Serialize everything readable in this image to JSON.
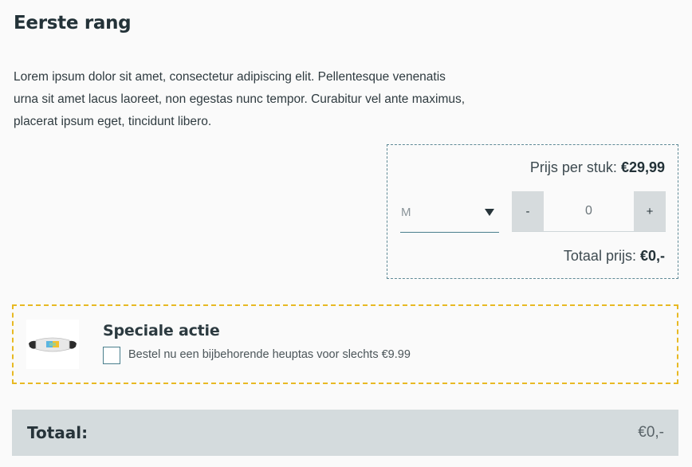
{
  "product": {
    "title": "Eerste rang",
    "description": "Lorem ipsum dolor sit amet, consectetur adipiscing elit. Pellentesque venenatis urna sit amet lacus laoreet, non egestas nunc tempor. Curabitur vel ante maximus, placerat ipsum eget, tincidunt libero."
  },
  "order": {
    "unit_price_label": "Prijs per stuk:",
    "unit_price_value": "€29,99",
    "size_selected": "M",
    "decrement_label": "-",
    "quantity": "0",
    "increment_label": "+",
    "total_price_label": "Totaal prijs:",
    "total_price_value": "€0,-"
  },
  "promo": {
    "title": "Speciale actie",
    "checkbox_label": "Bestel nu een bijbehorende heuptas voor slechts €9.99",
    "checked": false,
    "image_icon": "fanny-pack-product-image"
  },
  "summary": {
    "total_label": "Totaal:",
    "total_value": "€0,-"
  },
  "colors": {
    "accent_border": "#5f8a96",
    "promo_border": "#e8b923",
    "total_bar_bg": "#d4dbdd",
    "button_bg": "#d6dbdd"
  }
}
